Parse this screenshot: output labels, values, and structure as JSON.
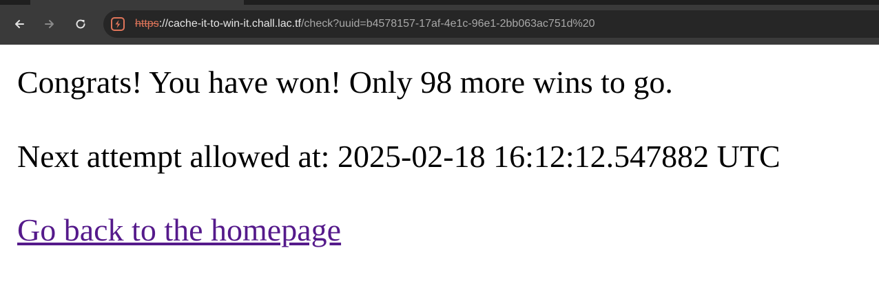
{
  "browser": {
    "url_scheme": "https",
    "url_host": "://cache-it-to-win-it.chall.lac.tf",
    "url_path": "/check?uuid=b4578157-17af-4e1c-96e1-2bb063ac751d%20",
    "icons": {
      "back": "arrow-left-icon",
      "forward": "arrow-right-icon",
      "reload": "reload-icon",
      "security": "not-secure-lock-icon"
    },
    "colors": {
      "toolbar": "#3a3a3a",
      "omnibox": "#262626",
      "scheme_warning": "#e0755a"
    }
  },
  "page": {
    "message": "Congrats! You have won! Only 98 more wins to go.",
    "next_attempt": "Next attempt allowed at: 2025-02-18 16:12:12.547882 UTC",
    "homepage_link": "Go back to the homepage",
    "link_color": "#551a8b"
  }
}
